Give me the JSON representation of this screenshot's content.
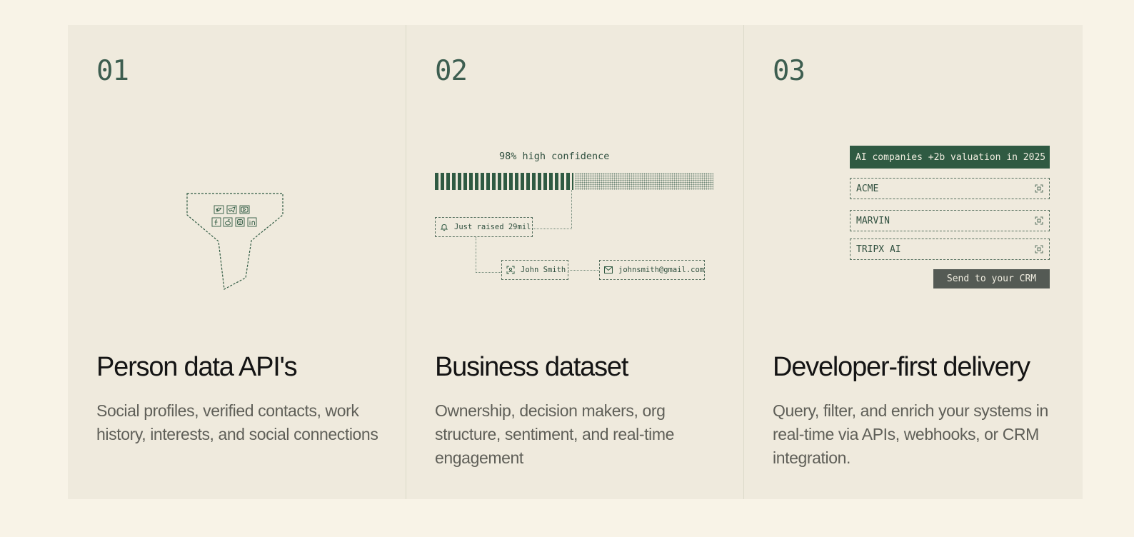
{
  "features": [
    {
      "number": "01",
      "title": "Person data API's",
      "description": "Social profiles, verified contacts, work history, interests, and social connections",
      "illustration": {
        "type": "funnel",
        "icons": [
          "twitter-icon",
          "telegram-icon",
          "youtube-icon",
          "facebook-icon",
          "reddit-icon",
          "instagram-icon",
          "linkedin-icon"
        ]
      }
    },
    {
      "number": "02",
      "title": "Business dataset",
      "description": "Ownership, decision makers, org structure, sentiment, and real-time engagement",
      "illustration": {
        "confidence_label": "98% high confidence",
        "confidence_fraction": 0.5,
        "event_tag": "Just raised 29mil",
        "person_tag": "John Smith",
        "email_tag": "johnsmith@gmail.com"
      }
    },
    {
      "number": "03",
      "title": "Developer-first delivery",
      "description": "Query, filter, and enrich your systems in real-time via APIs, webhooks, or CRM integration.",
      "illustration": {
        "query": "AI companies +2b valuation in 2025",
        "results": [
          "ACME",
          "MARVIN",
          "TRIPX AI"
        ],
        "button": "Send to your CRM"
      }
    }
  ],
  "colors": {
    "page_bg": "#f8f3e7",
    "panel_bg": "#efeadd",
    "accent_green": "#2f5a42",
    "number_color": "#3d5e50",
    "button_gray": "#545a54"
  }
}
